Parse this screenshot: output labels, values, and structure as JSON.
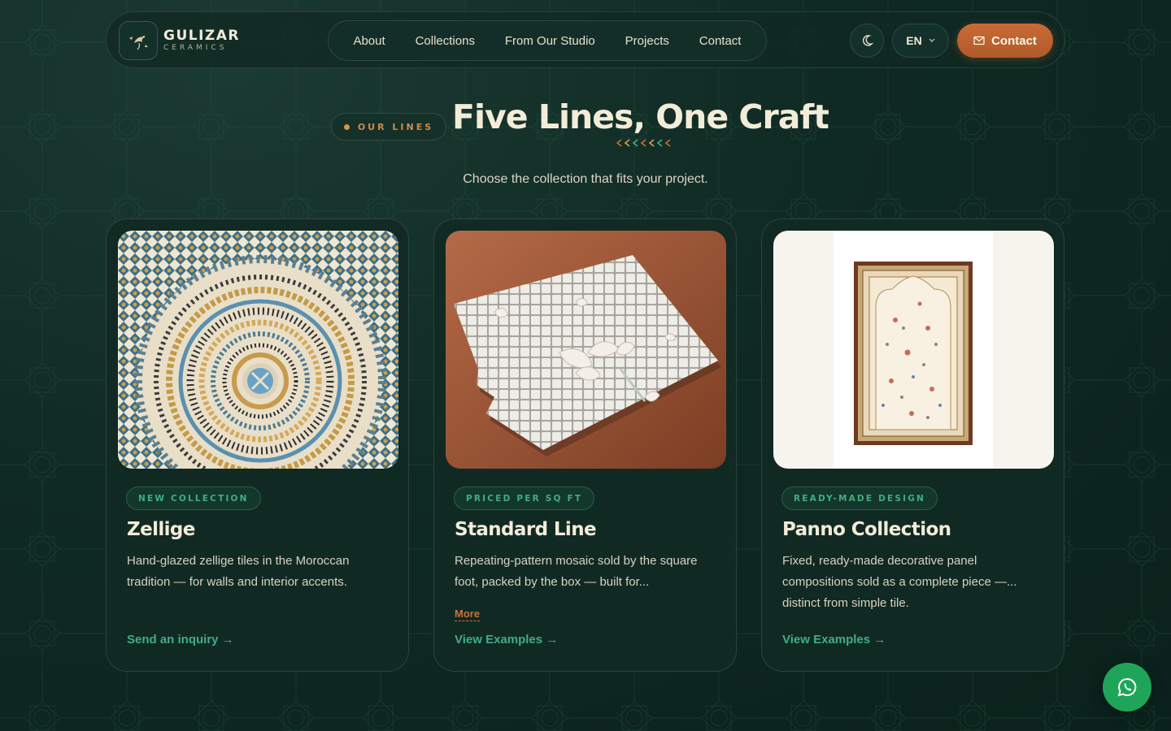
{
  "brand": {
    "name": "GULIZAR",
    "sub": "CERAMICS"
  },
  "nav": {
    "items": [
      "About",
      "Collections",
      "From Our Studio",
      "Projects",
      "Contact"
    ]
  },
  "header": {
    "lang": "EN",
    "contact_label": "Contact"
  },
  "section": {
    "eyebrow": "OUR LINES",
    "title": "Five Lines, One Craft",
    "subtitle": "Choose the collection that fits your project."
  },
  "cards": [
    {
      "badge": "NEW COLLECTION",
      "title": "Zellige",
      "desc": "Hand-glazed zellige tiles in the Moroccan tradition — for walls and interior accents.",
      "cta": "Send an inquiry →"
    },
    {
      "badge": "PRICED PER SQ FT",
      "title": "Standard Line",
      "desc": "Repeating-pattern mosaic sold by the square foot, packed by the box — built for...",
      "more": "More",
      "cta": "View Examples →"
    },
    {
      "badge": "READY-MADE DESIGN",
      "title": "Panno Collection",
      "desc": "Fixed, ready-made decorative panel compositions sold as a complete piece —... distinct from simple tile.",
      "cta": "View Examples →"
    }
  ],
  "icons": {
    "logo": "bird-flower-logo-icon",
    "theme": "moon-icon",
    "lang_caret": "chevron-down-icon",
    "contact": "mail-icon",
    "whatsapp": "whatsapp-icon"
  },
  "colors": {
    "background": "#0f2a23",
    "accent_orange": "#c96b35",
    "accent_green": "#3fae83",
    "whatsapp": "#1ea55a"
  }
}
